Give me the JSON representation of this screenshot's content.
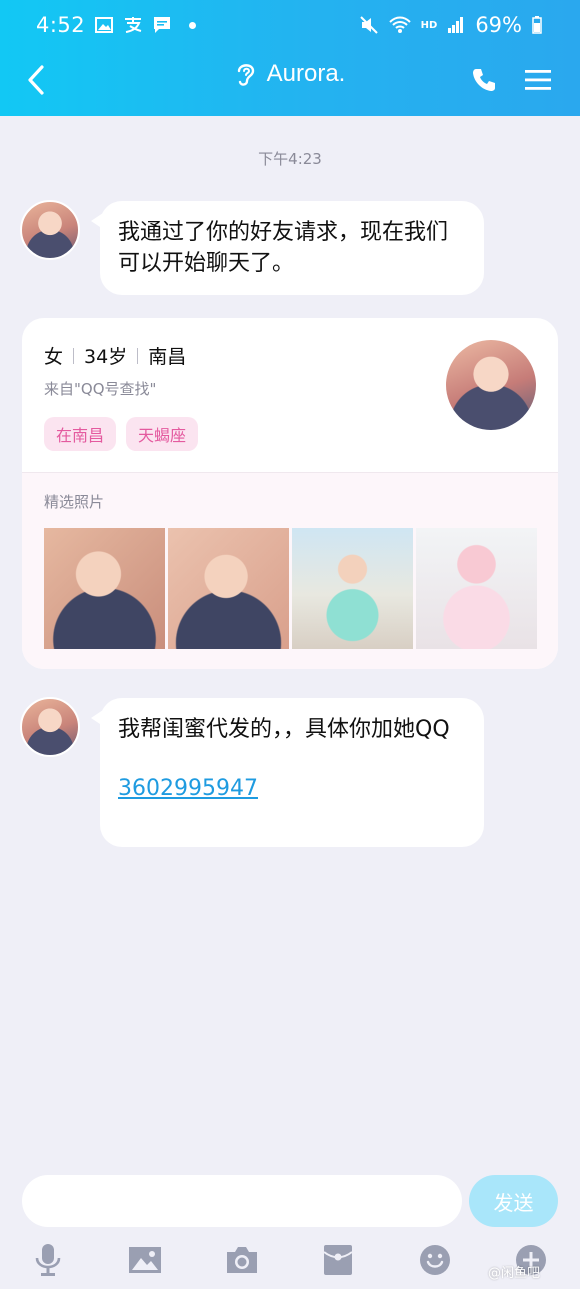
{
  "status_bar": {
    "time": "4:52",
    "battery": "69%",
    "hd_label": "HD"
  },
  "nav": {
    "title": "Aurora."
  },
  "chat": {
    "timestamp": "下午4:23",
    "messages": [
      {
        "text": "我通过了你的好友请求，现在我们可以开始聊天了。"
      },
      {
        "text": "我帮闺蜜代发的，，具体你加她QQ",
        "link": "3602995947"
      }
    ]
  },
  "profile_card": {
    "gender": "女",
    "age": "34岁",
    "city": "南昌",
    "source": "来自\"QQ号查找\"",
    "tags": [
      "在南昌",
      "天蝎座"
    ],
    "photos_label": "精选照片"
  },
  "input": {
    "placeholder": "",
    "send_label": "发送"
  },
  "watermark": "@闲鱼吧",
  "colors": {
    "header_start": "#12C8F4",
    "header_end": "#2AA8EE",
    "background": "#EFEFF7",
    "tag_bg": "#FBE4F0",
    "tag_text": "#E45A9F",
    "link": "#1E9BE0",
    "send_disabled": "#A9E6FA",
    "toolbar_icon": "#9A9FB2"
  }
}
